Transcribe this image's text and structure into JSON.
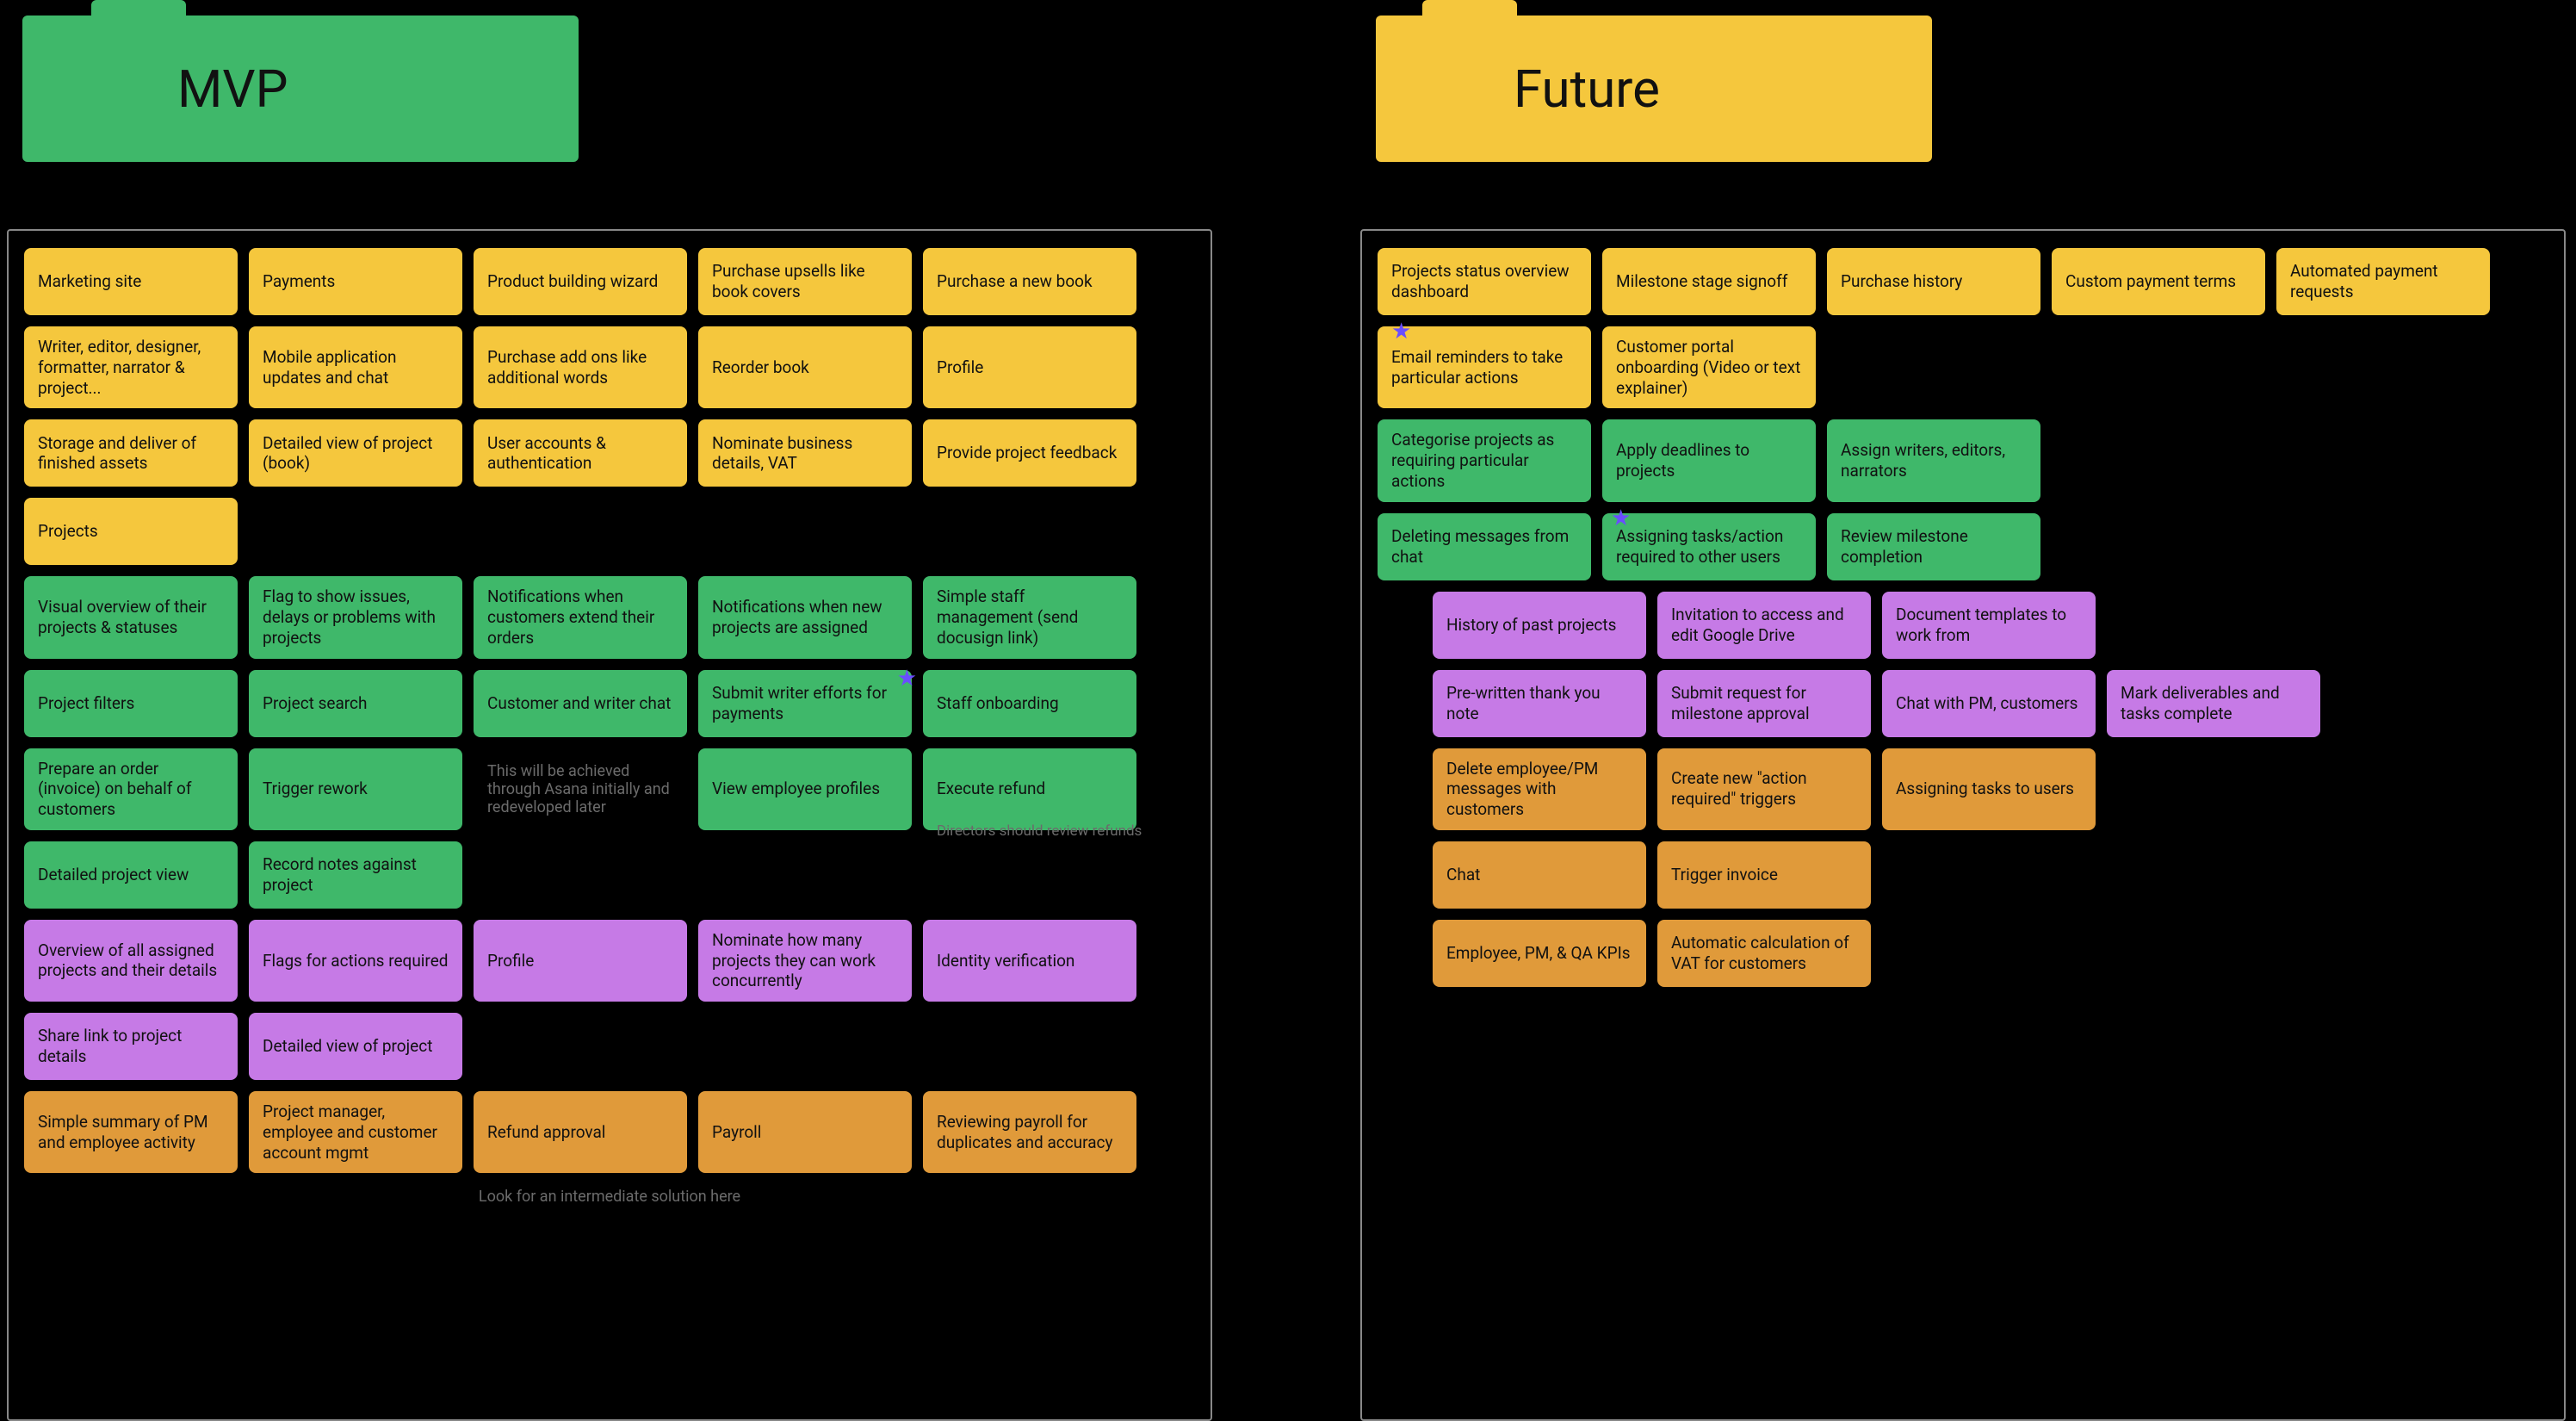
{
  "colors": {
    "yellow": "#f5c73d",
    "green": "#3fb86a",
    "purple": "#c67ae6",
    "orange": "#e09a3a"
  },
  "tabs": {
    "mvp": "MVP",
    "future": "Future"
  },
  "mvp": {
    "yellow": [
      "Marketing site",
      "Payments",
      "Product building wizard",
      "Purchase upsells like book covers",
      "Purchase a new book",
      "Writer, editor, designer, formatter, narrator & project...",
      "Mobile application updates and chat",
      "Purchase add ons like additional words",
      "Reorder book",
      "Profile",
      "Storage and deliver of finished assets",
      "Detailed view of project (book)",
      "User accounts & authentication",
      "Nominate business details, VAT",
      "Provide project feedback",
      "Projects"
    ],
    "green": [
      "Visual overview of their projects & statuses",
      "Flag to show issues, delays or problems with projects",
      "Notifications when customers extend their orders",
      "Notifications when new projects are assigned",
      "Simple staff management (send docusign link)",
      "Project filters",
      "Project search",
      "Customer and writer chat",
      "Submit writer efforts for payments",
      "Staff onboarding",
      "Prepare an order (invoice) on behalf of customers",
      "Trigger rework",
      "",
      "View employee profiles",
      "Execute refund",
      "Detailed project view",
      "Record notes against project"
    ],
    "greenNote": "This will be achieved through Asana initially and redeveloped later",
    "greenSideNote": "Directors should review refunds",
    "purple": [
      "Overview of all assigned projects and their details",
      "Flags for actions required",
      "Profile",
      "Nominate how many projects they can work concurrently",
      "Identity verification",
      "Share link to project details",
      "Detailed view of project"
    ],
    "orange": [
      "Simple summary of PM and employee activity",
      "Project manager, employee and customer account mgmt",
      "Refund approval",
      "Payroll",
      "Reviewing payroll for duplicates and accuracy"
    ],
    "bottomNote": "Look for an intermediate solution here"
  },
  "future": {
    "yellow": [
      "Projects status overview dashboard",
      "Milestone stage signoff",
      "Purchase history",
      "Custom payment terms",
      "Automated payment requests",
      "Email reminders to take particular actions",
      "Customer portal onboarding (Video or text explainer)"
    ],
    "green": [
      "Categorise projects as requiring particular actions",
      "Apply deadlines to projects",
      "Assign writers, editors, narrators",
      "Deleting messages from chat",
      "Assigning tasks/action required to other users",
      "Review milestone completion"
    ],
    "purple": [
      "History of past projects",
      "Invitation to access and edit Google Drive",
      "Document templates to work from",
      "Pre-written thank you note",
      "Submit request for milestone approval",
      "Chat with PM, customers",
      "Mark deliverables and tasks complete"
    ],
    "orange": [
      "Delete employee/PM messages with customers",
      "Create new \"action required\" triggers",
      "Assigning tasks to users",
      "Chat",
      "Trigger invoice",
      "Employee, PM, & QA KPIs",
      "Automatic calculation of VAT for customers"
    ]
  }
}
